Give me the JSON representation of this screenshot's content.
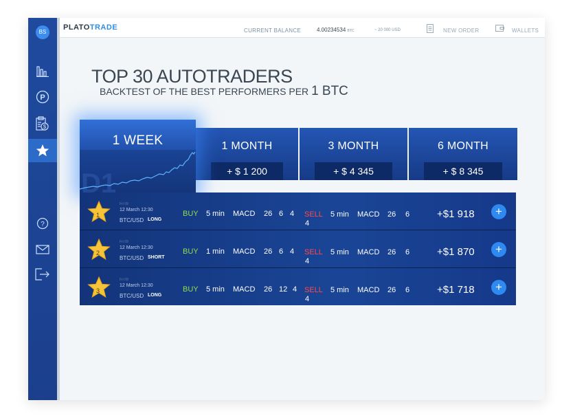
{
  "sidebar": {
    "avatar_initials": "BS",
    "items": [
      {
        "name": "stats",
        "icon": "bar-chart-icon"
      },
      {
        "name": "plato",
        "icon": "p-circle-icon"
      },
      {
        "name": "billing",
        "icon": "clipboard-dollar-icon"
      },
      {
        "name": "autotraders",
        "icon": "star-icon",
        "active": true
      },
      {
        "name": "help",
        "icon": "question-icon"
      },
      {
        "name": "messages",
        "icon": "mail-icon"
      },
      {
        "name": "logout",
        "icon": "logout-icon"
      }
    ]
  },
  "topbar": {
    "logo_part1": "PLATO",
    "logo_part2": "TRADE",
    "balance_label": "CURRENT BALANCE",
    "balance_value": "4.00234534",
    "balance_unit": "BTC",
    "balance_usd": "~ 20 000 USD",
    "new_order_label": "NEW ORDER",
    "wallets_label": "WALLETS"
  },
  "page": {
    "title": "TOP 30 AUTOTRADERS",
    "subtitle_prefix": "BACKTEST OF THE BEST PERFORMERS PER",
    "subtitle_amount": "1 BTC"
  },
  "tabs": [
    {
      "label": "1 WEEK",
      "active": true,
      "watermark": "D1"
    },
    {
      "label": "1 MONTH",
      "value": "+ $ 1 200"
    },
    {
      "label": "3 MONTH",
      "value": "+ $ 4 345"
    },
    {
      "label": "6 MONTH",
      "value": "+ $ 8 345"
    }
  ],
  "rows": [
    {
      "rank": "1",
      "faint": "Fri 09",
      "date": "12 March  12:30",
      "pair": "BTC/USD",
      "direction": "LONG",
      "buy": {
        "label": "BUY",
        "interval": "5 min",
        "indicator": "MACD",
        "p1": "26",
        "p2": "6",
        "p3": "4"
      },
      "sell": {
        "label": "SELL",
        "interval": "5 min",
        "indicator": "MACD",
        "p1": "26",
        "p2": "6",
        "p3": "4"
      },
      "profit": "+$1 918"
    },
    {
      "rank": "2",
      "faint": "Fri 09",
      "date": "12 March  12:30",
      "pair": "BTC/USD",
      "direction": "SHORT",
      "buy": {
        "label": "BUY",
        "interval": "1 min",
        "indicator": "MACD",
        "p1": "26",
        "p2": "6",
        "p3": "4"
      },
      "sell": {
        "label": "SELL",
        "interval": "5 min",
        "indicator": "MACD",
        "p1": "26",
        "p2": "6",
        "p3": "4"
      },
      "profit": "+$1 870"
    },
    {
      "rank": "3",
      "faint": "Fri 09",
      "date": "12 March  12:30",
      "pair": "BTC/USD",
      "direction": "LONG",
      "buy": {
        "label": "BUY",
        "interval": "5 min",
        "indicator": "MACD",
        "p1": "26",
        "p2": "12",
        "p3": "4"
      },
      "sell": {
        "label": "SELL",
        "interval": "5 min",
        "indicator": "MACD",
        "p1": "26",
        "p2": "6",
        "p3": "4"
      },
      "profit": "+$1 718"
    }
  ],
  "add_button_symbol": "+",
  "colors": {
    "sidebar": "#1f4a9e",
    "accent": "#2f8fe0",
    "buy": "#8de04a",
    "sell": "#ff4a4a",
    "row_bg": "#16398a"
  }
}
